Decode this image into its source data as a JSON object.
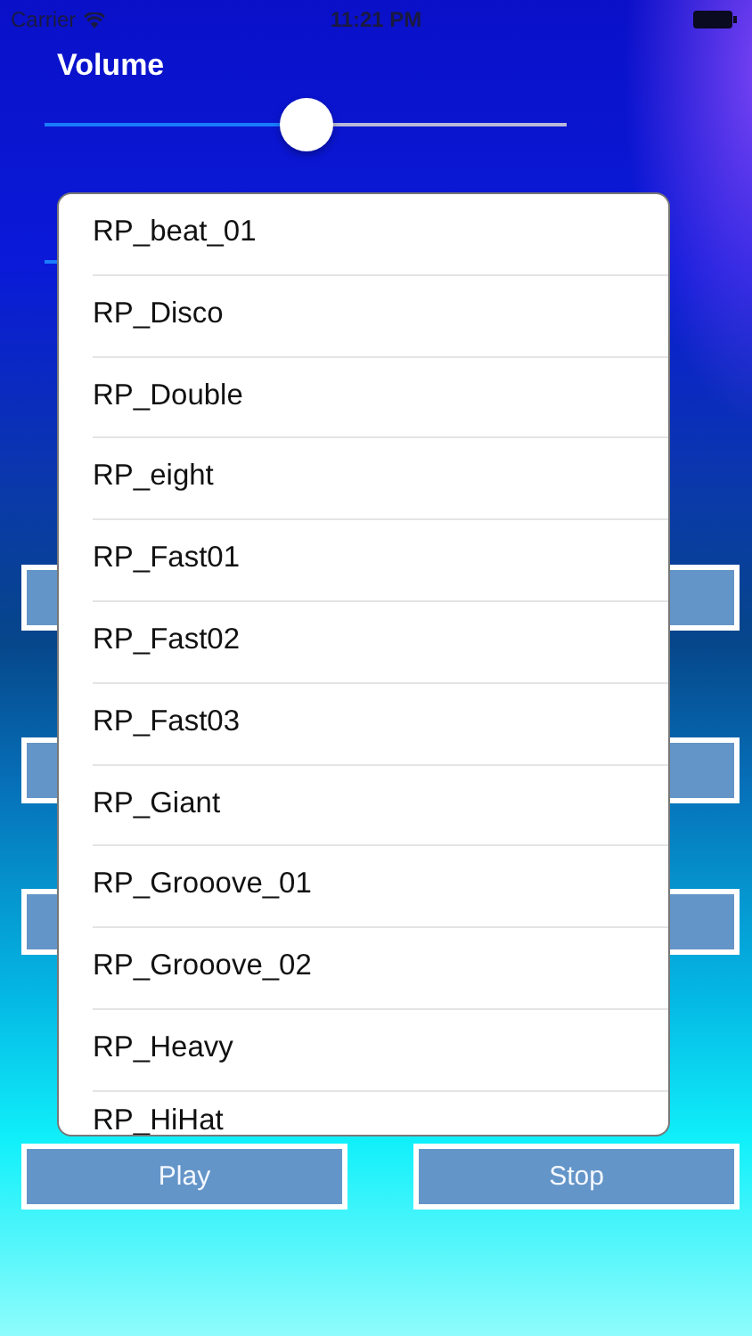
{
  "status_bar": {
    "carrier": "Carrier",
    "time": "11:21 PM"
  },
  "volume": {
    "label": "Volume",
    "level": 0.5
  },
  "hidden_buttons": [
    {
      "kind": "button"
    },
    {
      "kind": "button"
    },
    {
      "kind": "button"
    }
  ],
  "popup_list": {
    "items": [
      {
        "label": "RP_beat_01"
      },
      {
        "label": "RP_Disco"
      },
      {
        "label": "RP_Double"
      },
      {
        "label": "RP_eight"
      },
      {
        "label": "RP_Fast01"
      },
      {
        "label": "RP_Fast02"
      },
      {
        "label": "RP_Fast03"
      },
      {
        "label": "RP_Giant"
      },
      {
        "label": "RP_Grooove_01"
      },
      {
        "label": "RP_Grooove_02"
      },
      {
        "label": "RP_Heavy"
      },
      {
        "label": "RP_HiHat"
      }
    ]
  },
  "buttons": [
    "Play",
    "Stop"
  ]
}
